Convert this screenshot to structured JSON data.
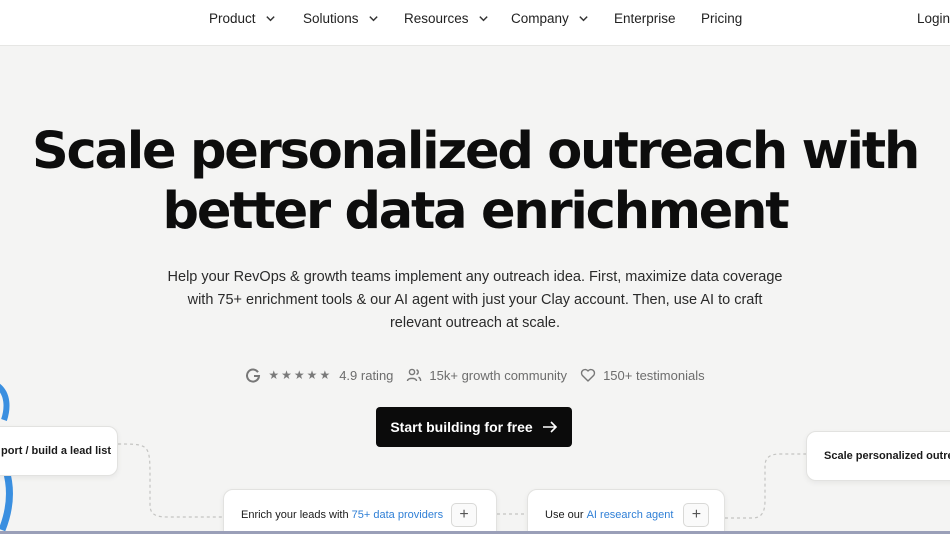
{
  "nav": {
    "items": [
      {
        "label": "Product",
        "dropdown": true
      },
      {
        "label": "Solutions",
        "dropdown": true
      },
      {
        "label": "Resources",
        "dropdown": true
      },
      {
        "label": "Company",
        "dropdown": true
      },
      {
        "label": "Enterprise",
        "dropdown": false
      },
      {
        "label": "Pricing",
        "dropdown": false
      }
    ],
    "login_label": "Login"
  },
  "hero": {
    "title_line1": "Scale personalized outreach with",
    "title_line2": "better data enrichment",
    "subtitle_line1": "Help your RevOps & growth teams implement any outreach idea. First, maximize data coverage",
    "subtitle_line2": "with 75+ enrichment tools & our AI agent with just your Clay account. Then, use AI to craft",
    "subtitle_line3": "relevant outreach at scale."
  },
  "stats": {
    "rating_stars": "★★★★★",
    "rating": "4.9 rating",
    "community": "15k+ growth community",
    "testimonials": "150+ testimonials"
  },
  "cta": {
    "label": "Start building for free"
  },
  "cards": {
    "import": {
      "text": "port / build a lead list"
    },
    "enrich": {
      "prefix": "Enrich your leads with ",
      "highlight": "75+ data providers",
      "plus": "+"
    },
    "research": {
      "prefix": "Use our ",
      "highlight": "AI research agent",
      "plus": "+"
    },
    "scale": {
      "text": "Scale personalized outrea"
    }
  },
  "colors": {
    "accent_link": "#2f7fd6",
    "cta_bg": "#0b0b0b",
    "page_bg": "#f4f4f3"
  },
  "icons": {
    "g2": "g2-logo-icon",
    "users": "users-icon",
    "heart": "heart-icon",
    "arrow": "arrow-right-icon"
  }
}
